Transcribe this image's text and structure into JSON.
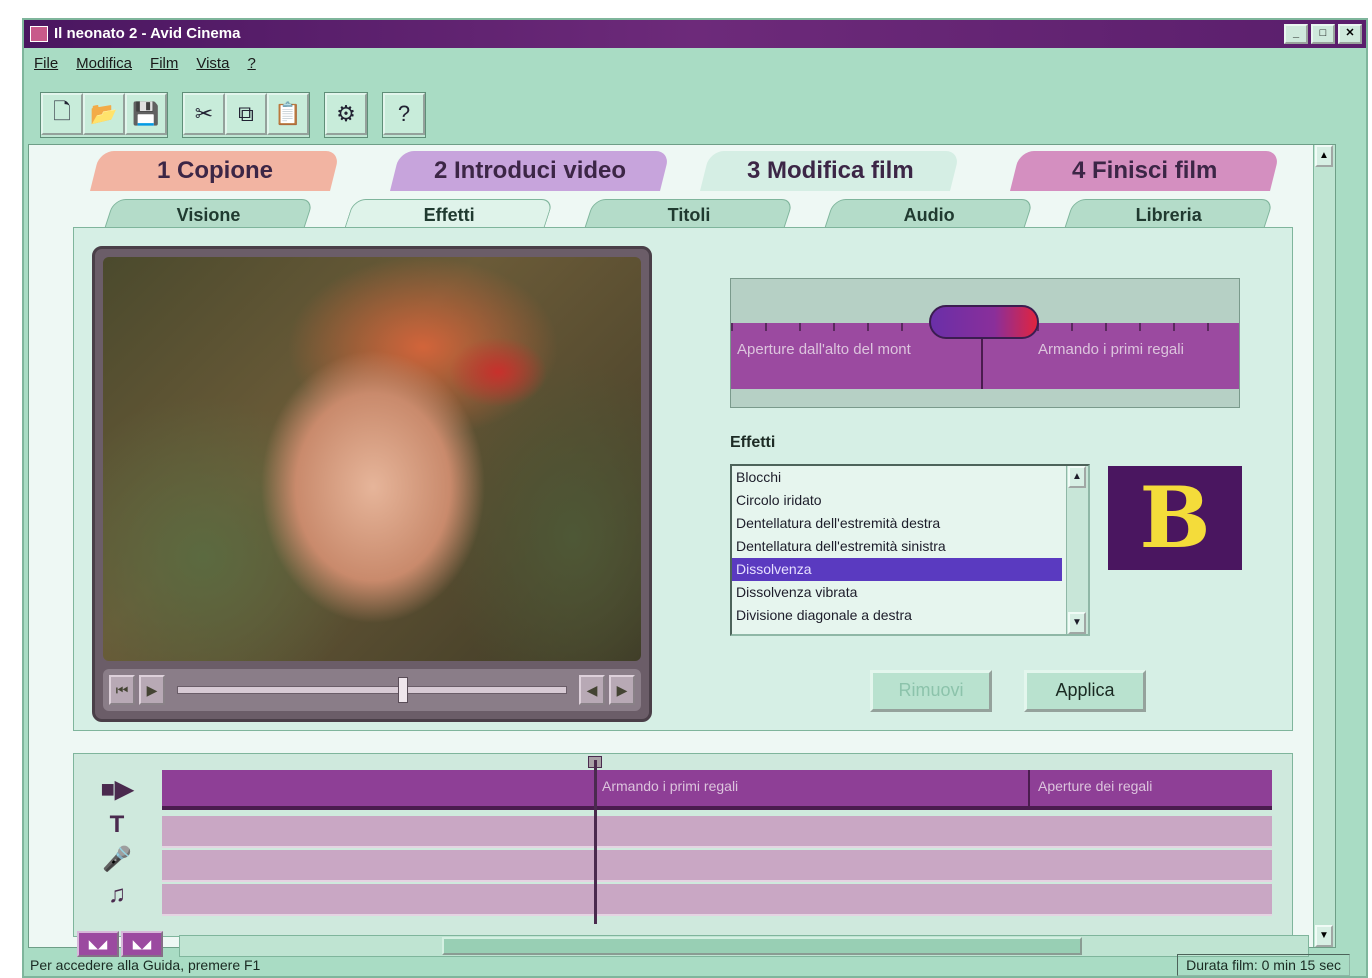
{
  "window": {
    "title": "Il neonato 2 - Avid Cinema",
    "controls": [
      "_",
      "□",
      "✕"
    ]
  },
  "menu": [
    "File",
    "Modifica",
    "Film",
    "Vista",
    "?"
  ],
  "toolbar": {
    "groups": [
      [
        "new-icon",
        "open-icon",
        "save-icon"
      ],
      [
        "cut-icon",
        "copy-icon",
        "paste-icon"
      ],
      [
        "record-icon"
      ],
      [
        "help-icon"
      ]
    ]
  },
  "main_tabs": [
    {
      "label": "1 Copione",
      "color": "#f2b4a2"
    },
    {
      "label": "2 Introduci video",
      "color": "#c7a4dc"
    },
    {
      "label": "3 Modifica film",
      "color": "#d5eee4"
    },
    {
      "label": "4 Finisci film",
      "color": "#d48fc0"
    }
  ],
  "sub_tabs": [
    "Visione",
    "Effetti",
    "Titoli",
    "Audio",
    "Libreria"
  ],
  "active_sub_tab": "Effetti",
  "transition": {
    "clip_left": "Aperture dall'alto del mont",
    "clip_right": "Armando i primi regali"
  },
  "effects": {
    "label": "Effetti",
    "items": [
      "Blocchi",
      "Circolo iridato",
      "Dentellatura dell'estremità destra",
      "Dentellatura dell'estremità sinistra",
      "Dissolvenza",
      "Dissolvenza vibrata",
      "Divisione diagonale a destra"
    ],
    "selected_index": 4,
    "preview_letter": "B"
  },
  "buttons": {
    "remove": "Rimuovi",
    "apply": "Applica"
  },
  "timeline": {
    "clips": [
      "Armando i primi regali",
      "Aperture dei regali"
    ]
  },
  "status": {
    "left": "Per accedere alla Guida, premere F1",
    "right": "Durata film: 0 min 15 sec"
  }
}
